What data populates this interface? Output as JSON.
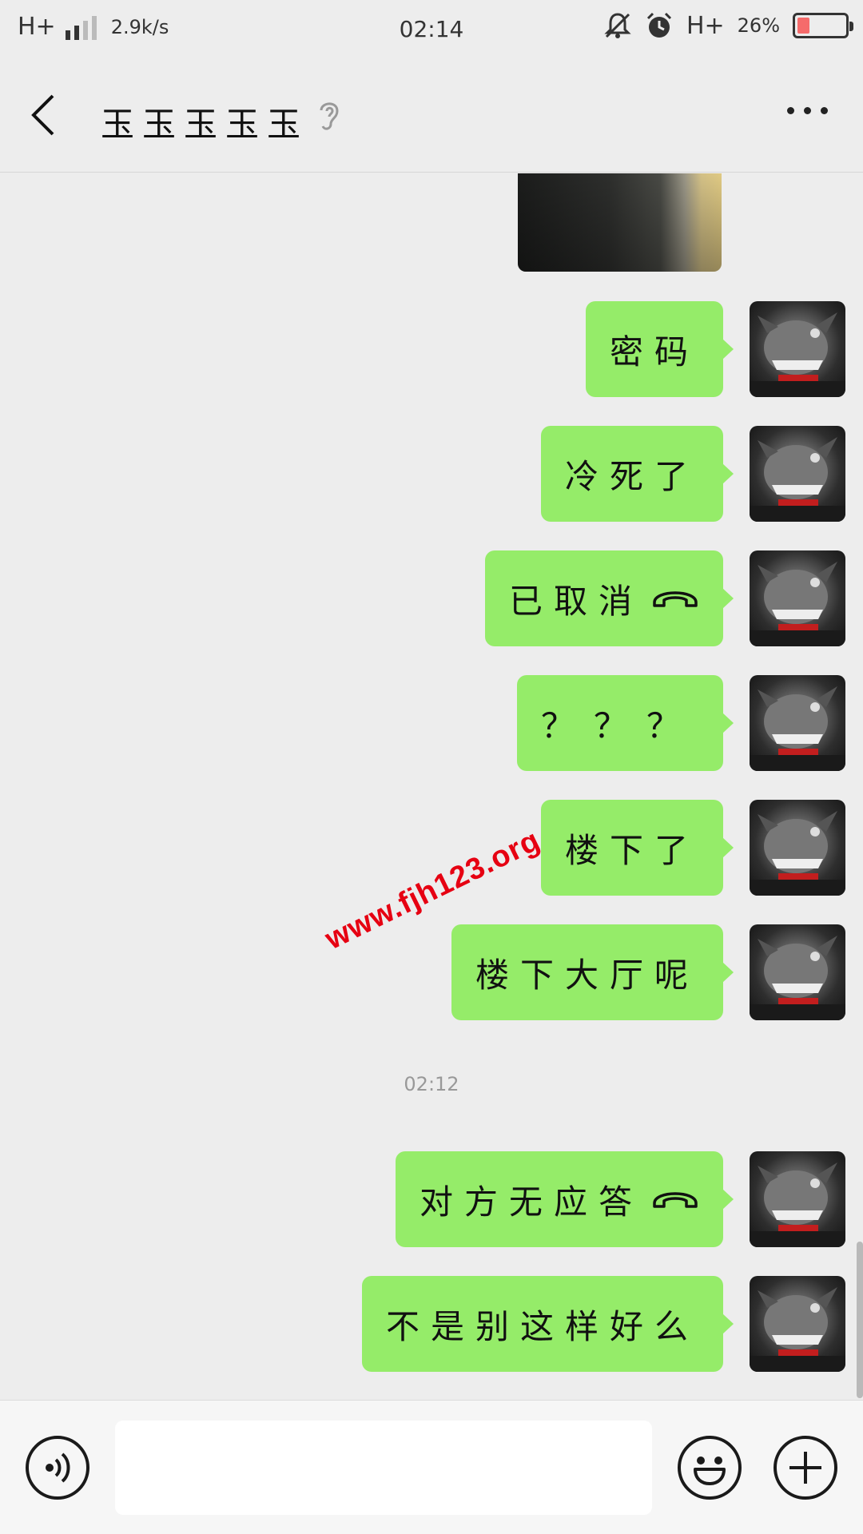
{
  "status_bar": {
    "network_type": "H+",
    "speed": "2.9k/s",
    "time": "02:14",
    "network_type_right": "H+",
    "battery_percent": "26%",
    "battery_level": 0.26
  },
  "header": {
    "title": "玉玉玉玉玉"
  },
  "messages": [
    {
      "type": "image",
      "from": "me"
    },
    {
      "type": "text",
      "from": "me",
      "text": "密码"
    },
    {
      "type": "text",
      "from": "me",
      "text": "冷死了"
    },
    {
      "type": "call",
      "from": "me",
      "text": "已取消"
    },
    {
      "type": "text",
      "from": "me",
      "text": "？？？"
    },
    {
      "type": "text",
      "from": "me",
      "text": "楼下了"
    },
    {
      "type": "text",
      "from": "me",
      "text": "楼下大厅呢"
    },
    {
      "type": "timestamp",
      "text": "02:12"
    },
    {
      "type": "call",
      "from": "me",
      "text": "对方无应答"
    },
    {
      "type": "text",
      "from": "me",
      "text": "不是别这样好么"
    }
  ],
  "watermark": "www.fjh123.org",
  "input": {
    "value": "",
    "placeholder": ""
  },
  "colors": {
    "bubble": "#95ec69",
    "background": "#ededed",
    "watermark": "#e60012"
  },
  "icons": [
    "back-arrow-icon",
    "ear-icon",
    "more-icon",
    "voice-icon",
    "emoji-icon",
    "plus-icon",
    "phone-hangup-icon",
    "mute-bell-icon",
    "alarm-icon"
  ]
}
